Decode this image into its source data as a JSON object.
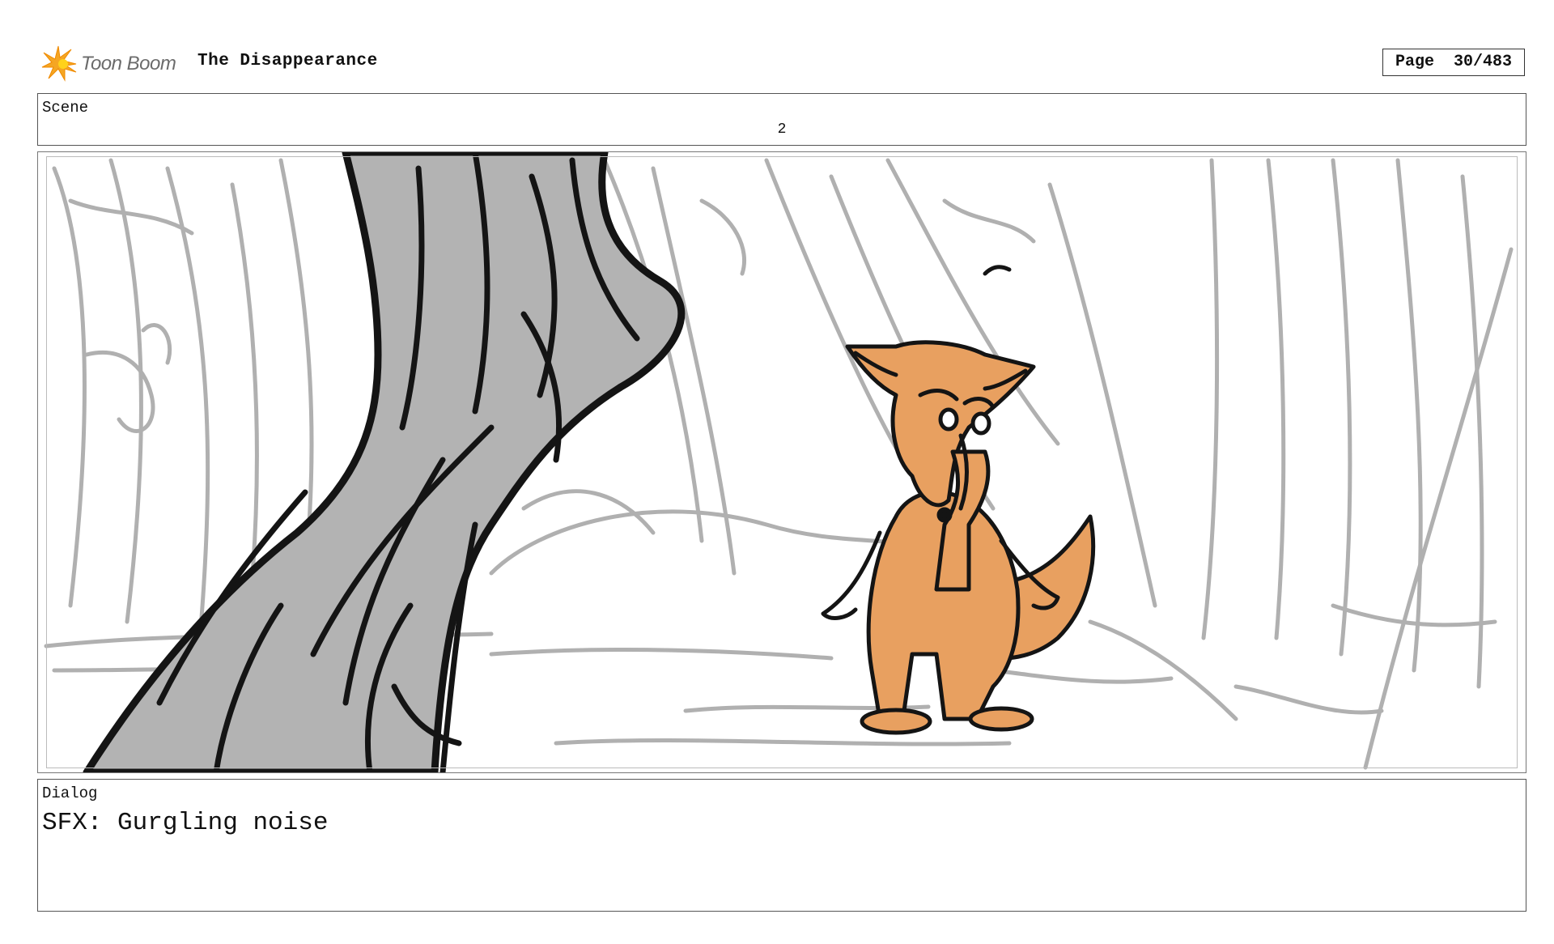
{
  "header": {
    "logo_text": "Toon Boom",
    "project_title": "The Disappearance",
    "page_label": "Page",
    "page_number": "30/483"
  },
  "scene": {
    "label": "Scene",
    "number": "2"
  },
  "dialog": {
    "label": "Dialog",
    "text": "SFX: Gurgling noise"
  },
  "icons": {
    "logo": "toon-boom-starburst-icon"
  },
  "colors": {
    "logo_orange": "#f5a623",
    "logo_yellow": "#ffd21a",
    "fox_orange": "#e8a060",
    "trunk_gray": "#b3b3b3",
    "sketch_gray": "#b0b0b0"
  }
}
